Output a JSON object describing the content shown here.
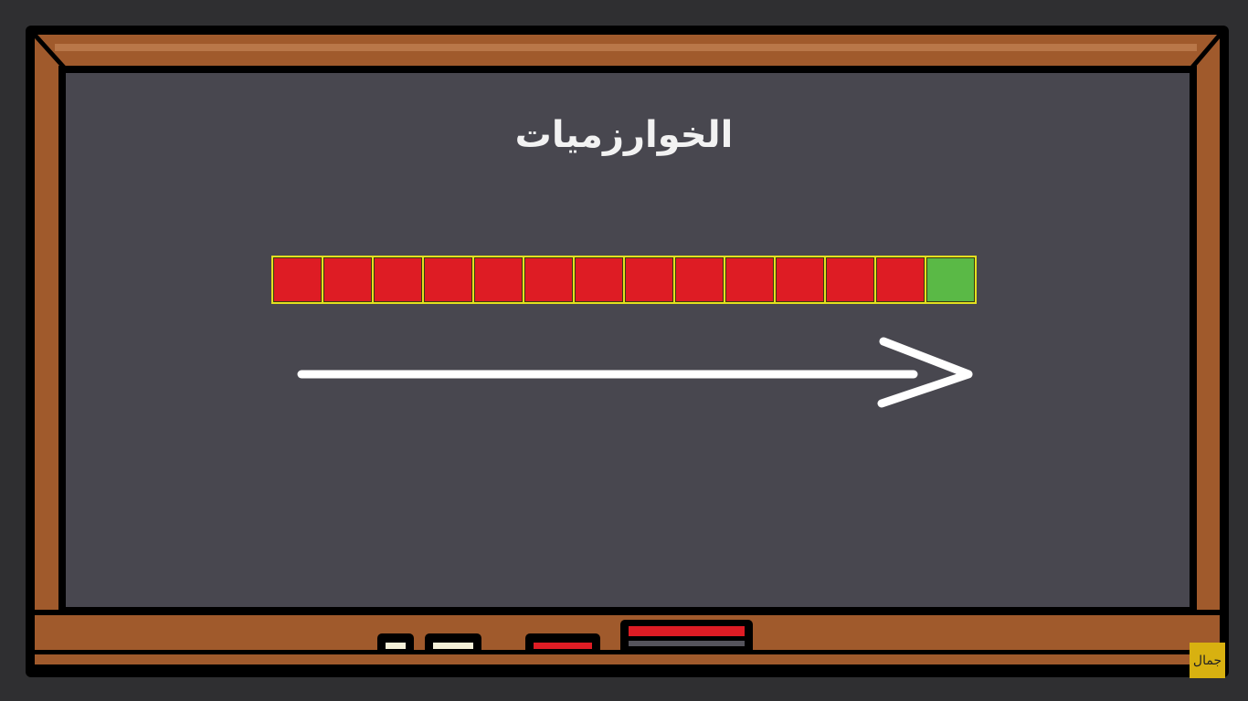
{
  "title": "الخوارزميات",
  "squares": [
    {
      "state": "red"
    },
    {
      "state": "red"
    },
    {
      "state": "red"
    },
    {
      "state": "red"
    },
    {
      "state": "red"
    },
    {
      "state": "red"
    },
    {
      "state": "red"
    },
    {
      "state": "red"
    },
    {
      "state": "red"
    },
    {
      "state": "red"
    },
    {
      "state": "red"
    },
    {
      "state": "red"
    },
    {
      "state": "red"
    },
    {
      "state": "green"
    }
  ],
  "colors": {
    "red": "#de1c24",
    "green": "#5ab946",
    "outline": "#e3e01f",
    "board": "#48474f",
    "wood": "#a05a2c"
  },
  "logo": "جمال"
}
